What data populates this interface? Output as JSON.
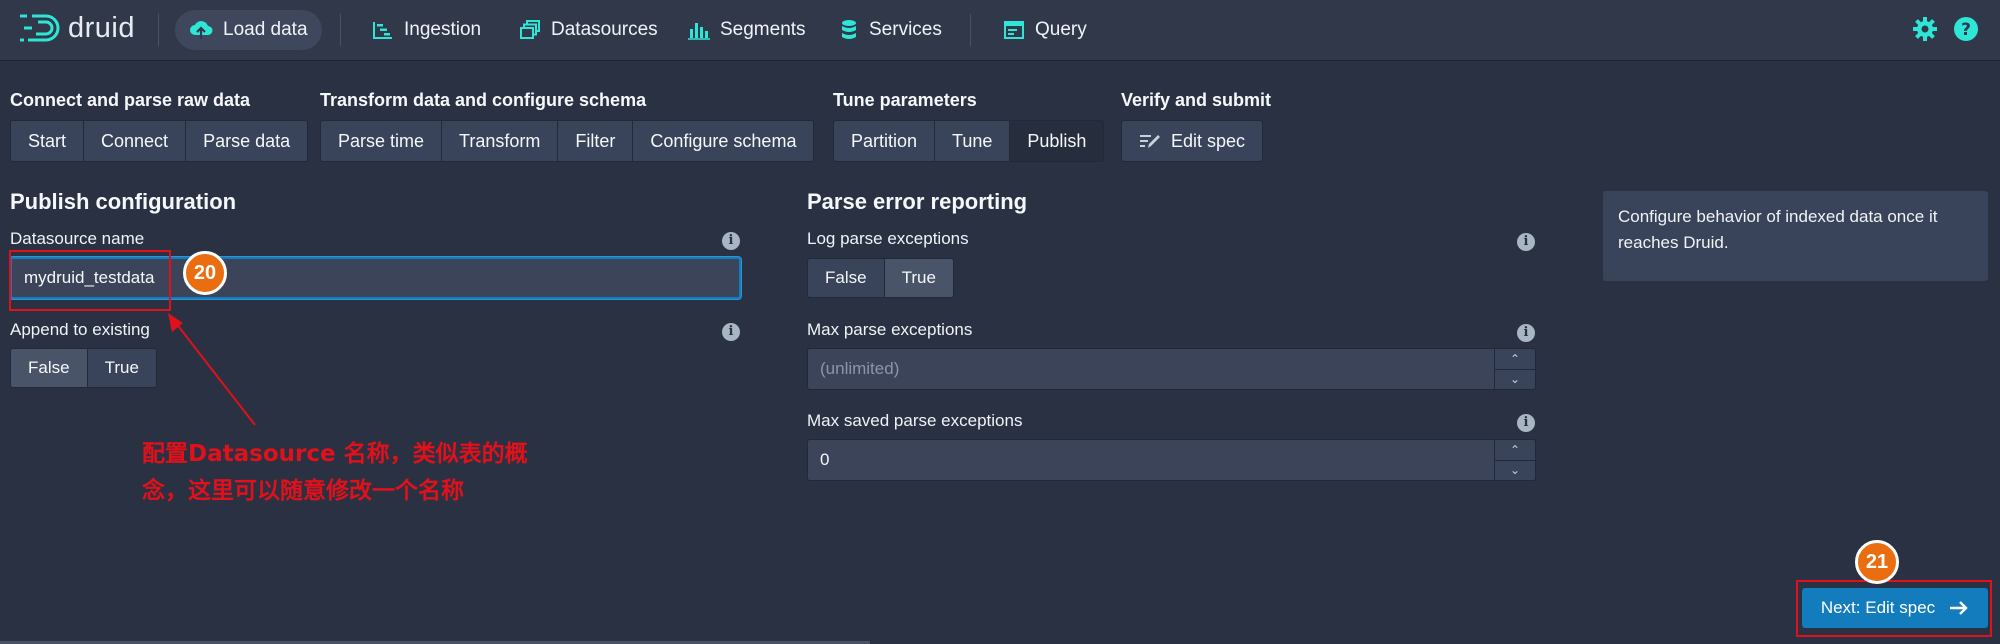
{
  "app": {
    "name": "druid"
  },
  "nav": {
    "load_data": "Load data",
    "ingestion": "Ingestion",
    "datasources": "Datasources",
    "segments": "Segments",
    "services": "Services",
    "query": "Query"
  },
  "steps": {
    "groups": [
      {
        "title": "Connect and parse raw data",
        "buttons": [
          "Start",
          "Connect",
          "Parse data"
        ]
      },
      {
        "title": "Transform data and configure schema",
        "buttons": [
          "Parse time",
          "Transform",
          "Filter",
          "Configure schema"
        ]
      },
      {
        "title": "Tune parameters",
        "buttons": [
          "Partition",
          "Tune",
          "Publish"
        ]
      },
      {
        "title": "Verify and submit",
        "buttons": [
          "Edit spec"
        ]
      }
    ],
    "active": "Publish"
  },
  "publish": {
    "title": "Publish configuration",
    "datasource_label": "Datasource name",
    "datasource_value": "mydruid_testdata",
    "append_label": "Append to existing",
    "append_false": "False",
    "append_true": "True",
    "append_selected": "False"
  },
  "parse_errors": {
    "title": "Parse error reporting",
    "log_label": "Log parse exceptions",
    "log_false": "False",
    "log_true": "True",
    "log_selected": "True",
    "max_label": "Max parse exceptions",
    "max_placeholder": "(unlimited)",
    "saved_label": "Max saved parse exceptions",
    "saved_value": "0"
  },
  "callout": {
    "text": "Configure behavior of indexed data once it reaches Druid."
  },
  "next_button": {
    "label": "Next: Edit spec"
  },
  "annotations": {
    "badge_20": "20",
    "badge_21": "21",
    "note": "配置Datasource 名称，类似表的概念，这里可以随意修改一个名称"
  },
  "colors": {
    "background": "#293142",
    "navbar": "#30384a",
    "accent": "#137cbd",
    "nav_icon": "#2ee6d6",
    "annotation_red": "#e0111b",
    "badge_orange": "#ea6d0f"
  }
}
